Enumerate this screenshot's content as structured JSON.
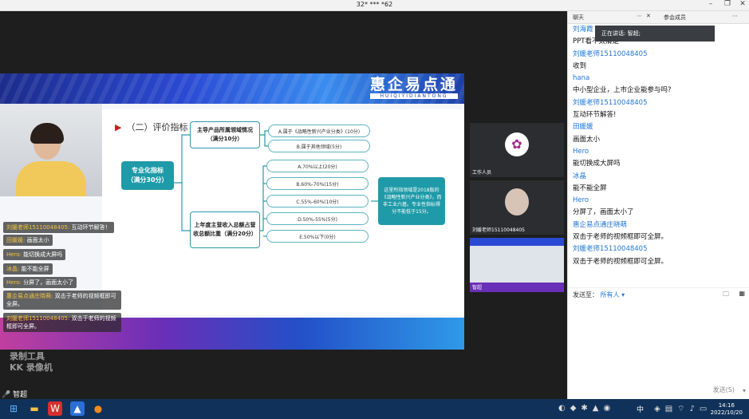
{
  "title_bar": {
    "title": "32* *** *62"
  },
  "slide": {
    "logo_cn": "惠企易点通",
    "logo_pinyin": "HUIQIYIDIANTONG",
    "heading": "（二）评价指标",
    "root": "专业化指标\n（满分30分）",
    "branch1": "主导产品所属领域情况（满分10分）",
    "branch2": "上年度主营收入总额占营收总额比重（满分20分）",
    "opts1": [
      "A.属于《战略性新兴产业分类》(10分)",
      "B.属于其他领域(5分)"
    ],
    "opts2": [
      "A.70%以上(20分)",
      "B.60%-70%(15分)",
      "C.55%-60%(10分)",
      "D.50%-55%(5分)",
      "E.50%以下(0分)"
    ],
    "note": "这里所指领域是2018版的《战略性新兴产业分类》，而非工业六基。专业性指标得分不能低于15分。"
  },
  "danmaku": [
    {
      "name": "刘媛老师15110048405:",
      "text": " 互动环节解答！"
    },
    {
      "name": "田媛媛:",
      "text": " 画面太小"
    },
    {
      "name": "Hero:",
      "text": " 能切换成大屏吗"
    },
    {
      "name": "冰晶:",
      "text": " 能不能全屏"
    },
    {
      "name": "Hero:",
      "text": " 分屏了，画面太小了"
    },
    {
      "name": "惠企易点通庄晓萌:",
      "text": " 双击于老师的视频框即可全屏。"
    },
    {
      "name": "刘媛老师15110048405:",
      "text": " 双击于老师的视频框即可全屏。"
    }
  ],
  "watermark": {
    "line1": "录制工具",
    "line2": "KK 录像机"
  },
  "self_name": "智超",
  "tiles": [
    {
      "caption": "工作人员"
    },
    {
      "caption": "刘媛老师15110048405"
    },
    {
      "caption": "智超"
    }
  ],
  "chat": {
    "tab_chat": "聊天",
    "tab_members": "参会成员",
    "speaking": "正在讲话: 智超;",
    "messages": [
      {
        "sender": "刘海霞",
        "text": "PPT看不太清楚"
      },
      {
        "sender": "刘媛老师15110048405",
        "text": "收到"
      },
      {
        "sender": "hana",
        "text": "中小型企业，上市企业能参与吗?"
      },
      {
        "sender": "刘媛老师15110048405",
        "text": "互动环节解答!"
      },
      {
        "sender": "田媛媛",
        "text": "画面太小"
      },
      {
        "sender": "Hero",
        "text": "能切换成大屏吗"
      },
      {
        "sender": "冰晶",
        "text": "能不能全屏"
      },
      {
        "sender": "Hero",
        "text": "分屏了，画面太小了"
      },
      {
        "sender": "惠企易点通庄晓萌",
        "text": "双击于老师的视频框即可全屏。"
      },
      {
        "sender": "刘媛老师15110048405",
        "text": "双击于老师的视频框即可全屏。"
      }
    ],
    "send_to_label": "发送至：",
    "send_to_value": "所有人",
    "send_button": "发送(S)"
  },
  "taskbar": {
    "ime": "中",
    "time": "14:16",
    "date": "2022/10/20"
  }
}
